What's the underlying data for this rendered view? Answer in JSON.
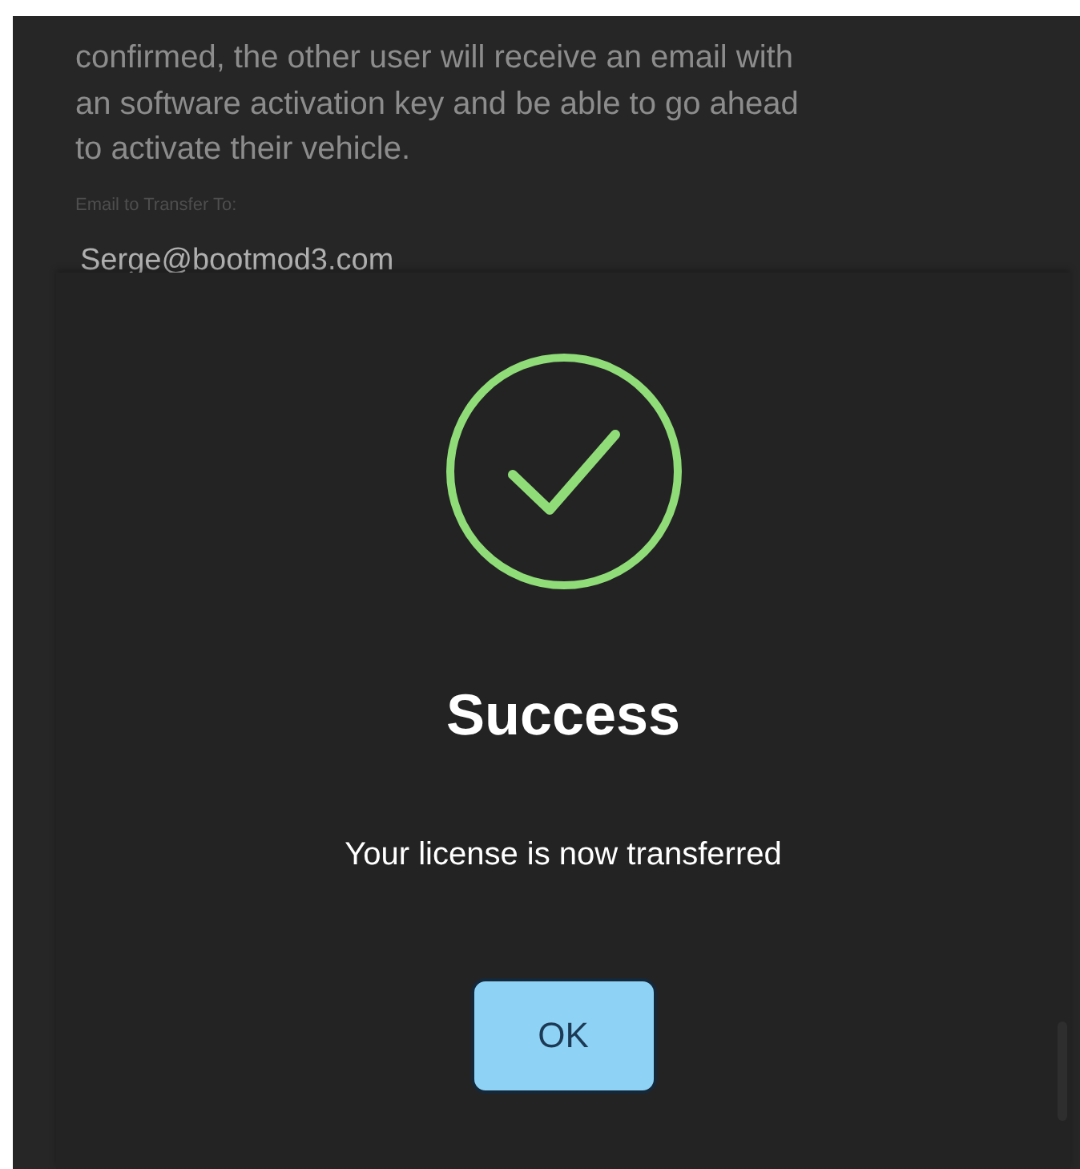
{
  "background": {
    "lines": [
      "confirmed, the other user will receive an email with",
      "an software activation key and be able to go ahead",
      "to activate their vehicle."
    ],
    "field_label": "Email to Transfer To:",
    "field_value": "Serge@bootmod3.com"
  },
  "dialog": {
    "title": "Success",
    "message": "Your license is now transferred",
    "button": "OK"
  }
}
